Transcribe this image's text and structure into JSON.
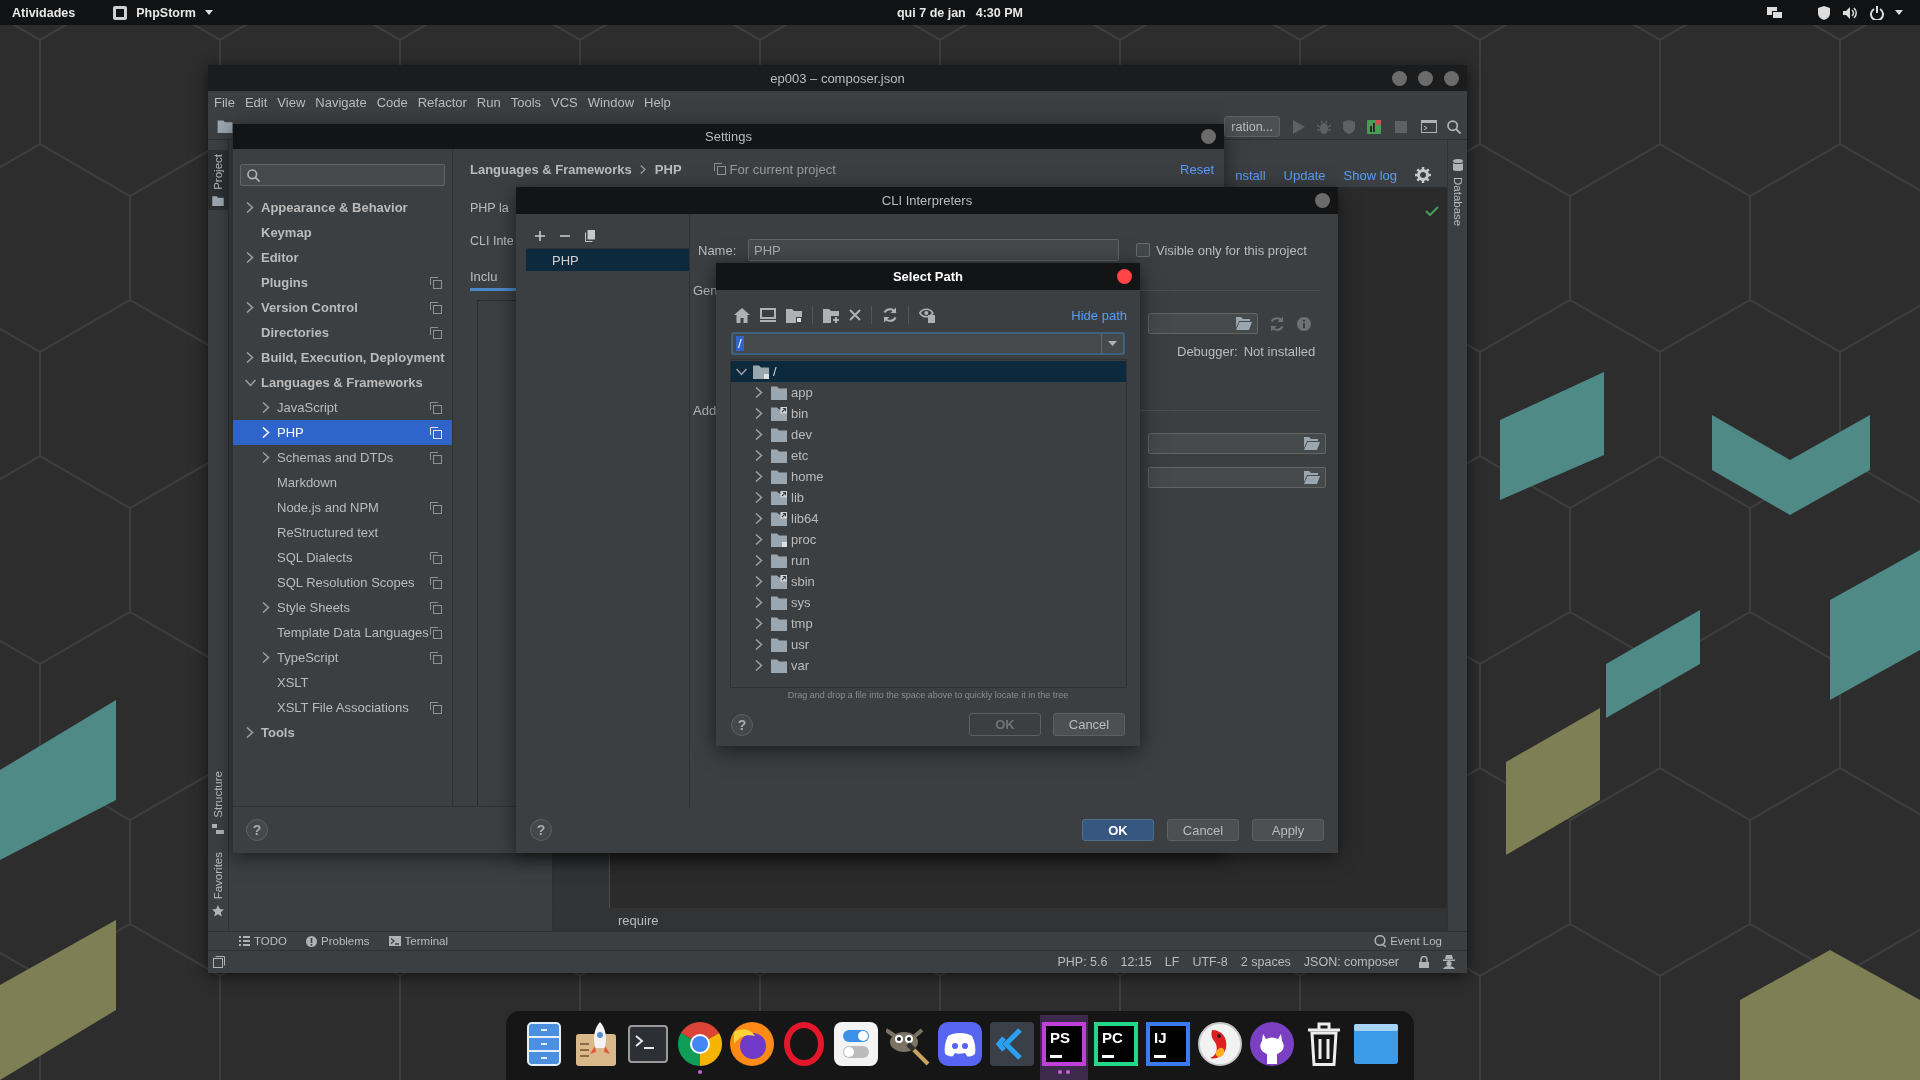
{
  "top_bar": {
    "activities": "Atividades",
    "app_menu": "PhpStorm",
    "date": "qui 7 de jan",
    "time": "4:30 PM"
  },
  "ide": {
    "title": "ep003 – composer.json",
    "menu": [
      "File",
      "Edit",
      "View",
      "Navigate",
      "Code",
      "Refactor",
      "Run",
      "Tools",
      "VCS",
      "Window",
      "Help"
    ],
    "run_configuration": "ration...",
    "left_tabs_top": [
      {
        "kind": "project",
        "label": "Project",
        "selected": true
      }
    ],
    "left_tabs_bottom": [
      {
        "kind": "structure",
        "label": "Structure",
        "selected": false
      },
      {
        "kind": "favorites",
        "label": "Favorites",
        "selected": false
      }
    ],
    "right_tabs": [
      {
        "kind": "database",
        "label": "Database",
        "selected": false
      }
    ],
    "composer_actions": [
      "nstall",
      "Update",
      "Show log"
    ],
    "breadcrumb": "require",
    "tool_windows": [
      {
        "kind": "todo",
        "label": "TODO"
      },
      {
        "kind": "problems",
        "label": "Problems"
      },
      {
        "kind": "terminal",
        "label": "Terminal"
      }
    ],
    "event_log": "Event Log",
    "status_items": [
      "PHP: 5.6",
      "12:15",
      "LF",
      "UTF-8",
      "2 spaces",
      "JSON: composer"
    ]
  },
  "settings": {
    "title": "Settings",
    "tree": [
      {
        "label": "Appearance & Behavior",
        "expanded": false,
        "selected": false,
        "project_level": false
      },
      {
        "label": "Keymap",
        "selected": false,
        "project_level": false
      },
      {
        "label": "Editor",
        "expanded": false,
        "selected": false,
        "project_level": false
      },
      {
        "label": "Plugins",
        "selected": false,
        "project_level": true
      },
      {
        "label": "Version Control",
        "expanded": false,
        "selected": false,
        "project_level": true
      },
      {
        "label": "Directories",
        "selected": false,
        "project_level": true
      },
      {
        "label": "Build, Execution, Deployment",
        "expanded": false,
        "selected": false,
        "project_level": false
      },
      {
        "label": "Languages & Frameworks",
        "expanded": true,
        "selected": false,
        "project_level": false,
        "children": [
          {
            "label": "JavaScript",
            "expanded": false,
            "selected": false,
            "project_level": true
          },
          {
            "label": "PHP",
            "expanded": false,
            "selected": true,
            "project_level": true
          },
          {
            "label": "Schemas and DTDs",
            "expanded": false,
            "selected": false,
            "project_level": true
          },
          {
            "label": "Markdown",
            "selected": false,
            "project_level": false
          },
          {
            "label": "Node.js and NPM",
            "selected": false,
            "project_level": true
          },
          {
            "label": "ReStructured text",
            "selected": false,
            "project_level": false
          },
          {
            "label": "SQL Dialects",
            "selected": false,
            "project_level": true
          },
          {
            "label": "SQL Resolution Scopes",
            "selected": false,
            "project_level": true
          },
          {
            "label": "Style Sheets",
            "expanded": false,
            "selected": false,
            "project_level": true
          },
          {
            "label": "Template Data Languages",
            "selected": false,
            "project_level": true
          },
          {
            "label": "TypeScript",
            "expanded": false,
            "selected": false,
            "project_level": true
          },
          {
            "label": "XSLT",
            "selected": false,
            "project_level": false
          },
          {
            "label": "XSLT File Associations",
            "selected": false,
            "project_level": true
          }
        ]
      },
      {
        "label": "Tools",
        "expanded": false,
        "selected": false,
        "project_level": false
      }
    ],
    "breadcrumb": [
      "Languages & Frameworks",
      "PHP"
    ],
    "scope": "For current project",
    "reset": "Reset",
    "labels": [
      "PHP la",
      "CLI Inte"
    ],
    "tabs": [
      {
        "label": "Inclu",
        "selected": true
      }
    ],
    "help": "?"
  },
  "cli_dialog": {
    "title": "CLI Interpreters",
    "interpreters": [
      {
        "name": "PHP",
        "selected": true
      }
    ],
    "name_label": "Name:",
    "name_value": "PHP",
    "visible_only": {
      "label": "Visible only for this project",
      "checked": false
    },
    "general": "Gen",
    "additional": "Add",
    "debugger_label": "Debugger:",
    "debugger_status": "Not installed",
    "help": "?",
    "buttons": [
      {
        "label": "OK",
        "primary": true
      },
      {
        "label": "Cancel",
        "primary": false
      },
      {
        "label": "Apply",
        "primary": false
      }
    ]
  },
  "select_path": {
    "title": "Select Path",
    "hide_path": "Hide path",
    "path": {
      "value": "/",
      "text_selected": true
    },
    "tree": [
      {
        "name": "/",
        "kind": "locked",
        "expanded": true,
        "selected": true,
        "children": [
          {
            "name": "app",
            "kind": "folder",
            "expanded": false,
            "selected": false
          },
          {
            "name": "bin",
            "kind": "link",
            "expanded": false,
            "selected": false
          },
          {
            "name": "dev",
            "kind": "folder",
            "expanded": false,
            "selected": false
          },
          {
            "name": "etc",
            "kind": "folder",
            "expanded": false,
            "selected": false
          },
          {
            "name": "home",
            "kind": "folder",
            "expanded": false,
            "selected": false
          },
          {
            "name": "lib",
            "kind": "link",
            "expanded": false,
            "selected": false
          },
          {
            "name": "lib64",
            "kind": "link",
            "expanded": false,
            "selected": false
          },
          {
            "name": "proc",
            "kind": "locked",
            "expanded": false,
            "selected": false
          },
          {
            "name": "run",
            "kind": "folder",
            "expanded": false,
            "selected": false
          },
          {
            "name": "sbin",
            "kind": "link",
            "expanded": false,
            "selected": false
          },
          {
            "name": "sys",
            "kind": "folder",
            "expanded": false,
            "selected": false
          },
          {
            "name": "tmp",
            "kind": "folder",
            "expanded": false,
            "selected": false
          },
          {
            "name": "usr",
            "kind": "folder",
            "expanded": false,
            "selected": false
          },
          {
            "name": "var",
            "kind": "folder",
            "expanded": false,
            "selected": false
          }
        ]
      }
    ],
    "hint": "Drag and drop a file into the space above to quickly locate it in the tree",
    "help": "?",
    "buttons": [
      {
        "label": "OK",
        "disabled": true
      },
      {
        "label": "Cancel",
        "disabled": false
      }
    ]
  },
  "dock": [
    {
      "kind": "drawers",
      "running": false,
      "focused": false
    },
    {
      "kind": "rocket",
      "running": false,
      "focused": false
    },
    {
      "kind": "terminal",
      "running": false,
      "focused": false
    },
    {
      "kind": "segmented_circle",
      "running": true,
      "multiple_windows": false,
      "focused": false
    },
    {
      "kind": "flame_globe",
      "running": false,
      "focused": false
    },
    {
      "kind": "ring",
      "running": false,
      "focused": false
    },
    {
      "kind": "toggles",
      "running": false,
      "focused": false
    },
    {
      "kind": "animal_brush",
      "running": false,
      "focused": false
    },
    {
      "kind": "controller",
      "running": false,
      "focused": false
    },
    {
      "kind": "chevron_tile",
      "running": false,
      "focused": false
    },
    {
      "kind": "tile",
      "label": "PS",
      "color": "#c03fd8",
      "running": true,
      "multiple_windows": true,
      "focused": true
    },
    {
      "kind": "tile",
      "label": "PC",
      "color": "#21d789",
      "running": false,
      "focused": false
    },
    {
      "kind": "tile",
      "label": "IJ",
      "color": "#3b7bf0",
      "running": false,
      "focused": false
    },
    {
      "kind": "bird",
      "running": false,
      "focused": false
    },
    {
      "kind": "cat",
      "running": false,
      "focused": false
    },
    {
      "kind": "trash",
      "running": false,
      "focused": false
    },
    {
      "kind": "window",
      "running": false,
      "focused": false
    }
  ]
}
